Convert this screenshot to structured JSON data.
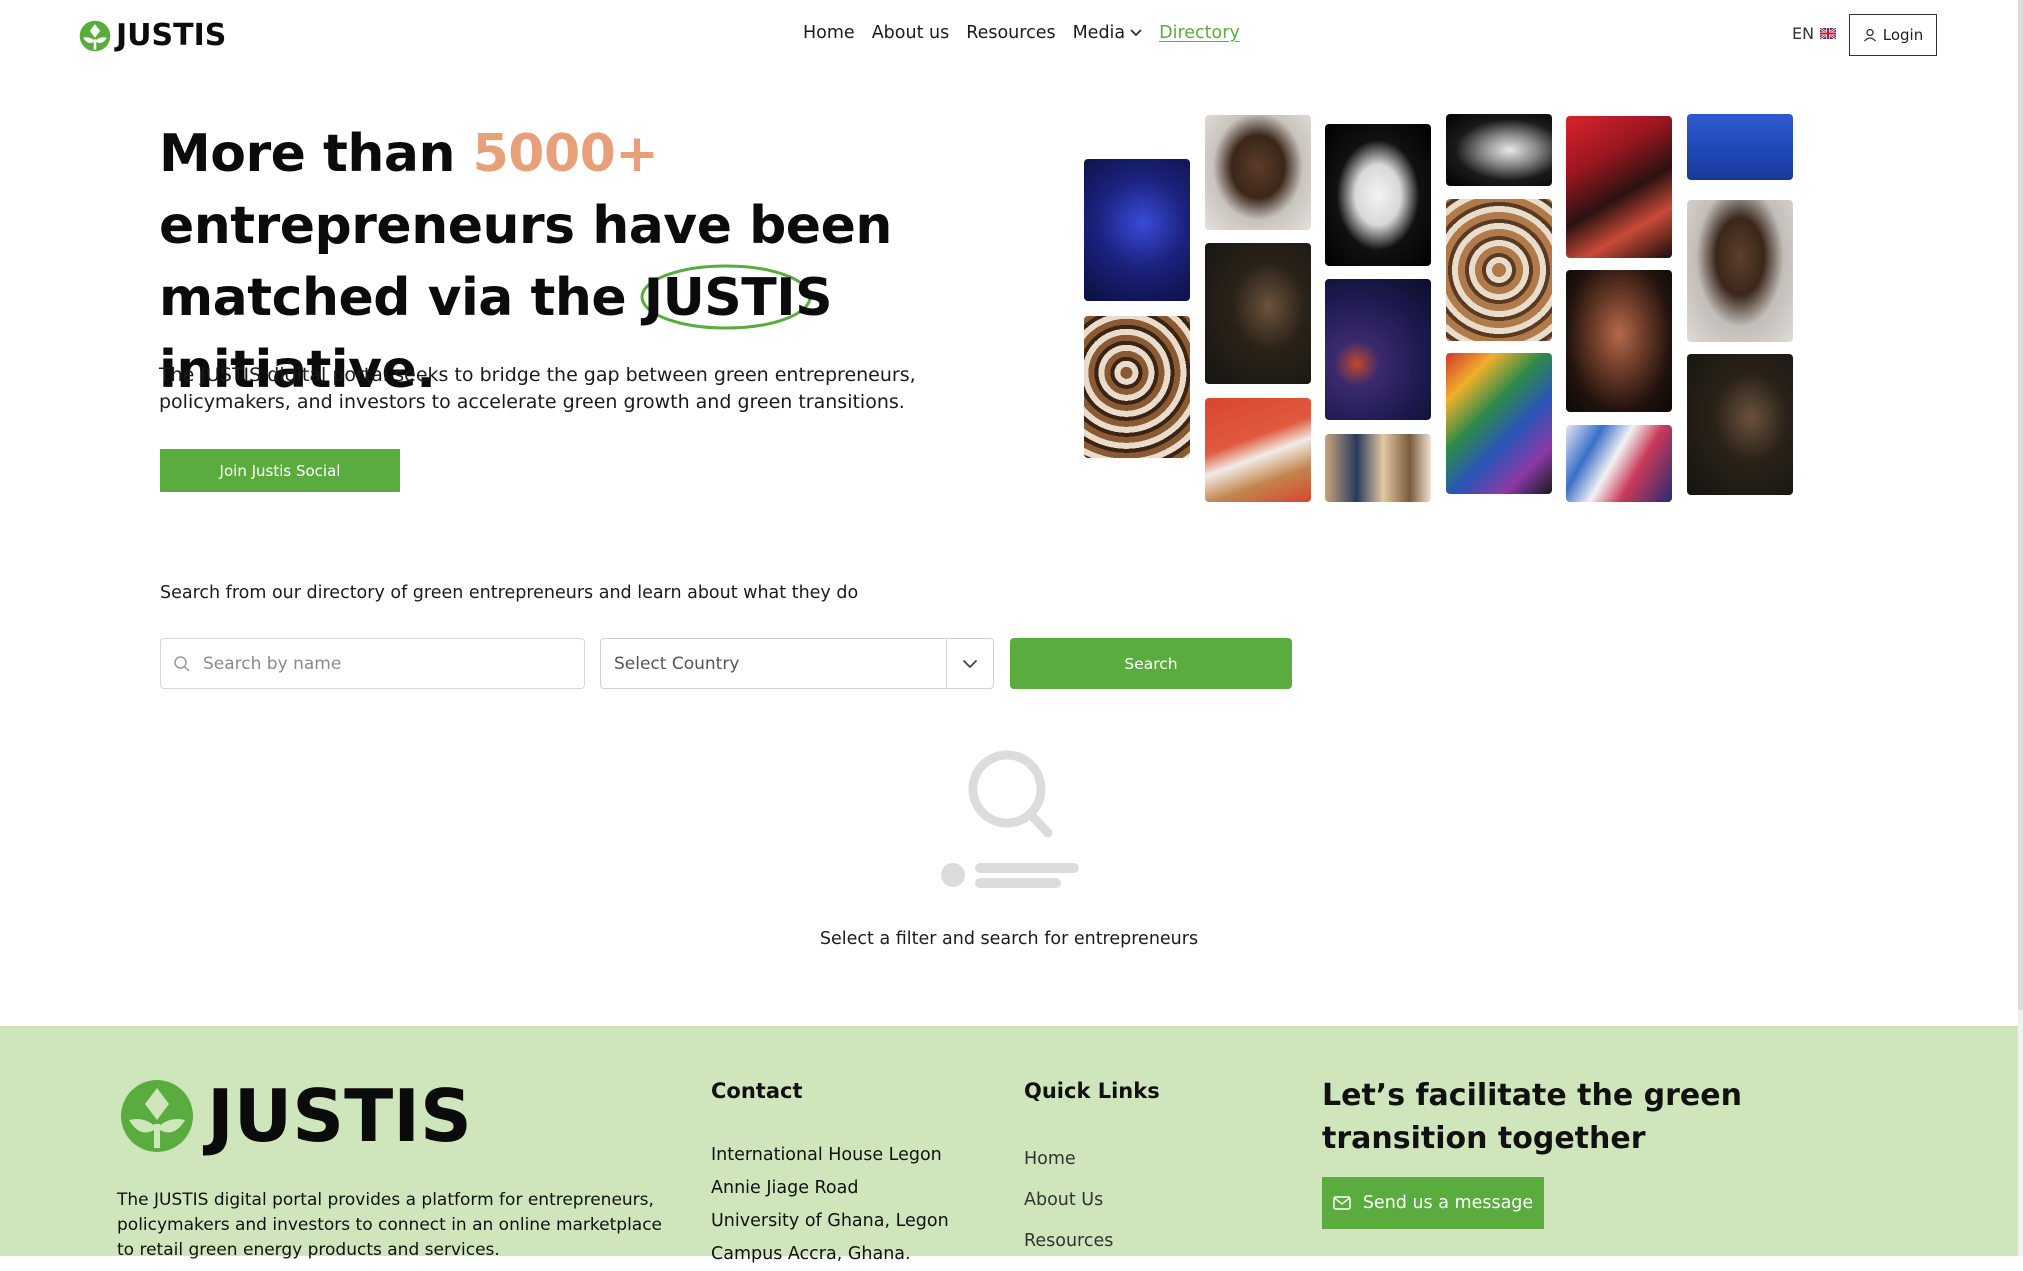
{
  "header": {
    "logo_text": "JUSTIS",
    "nav": {
      "home": "Home",
      "about": "About us",
      "resources": "Resources",
      "media": "Media",
      "directory": "Directory"
    },
    "lang": "EN",
    "login": "Login"
  },
  "hero": {
    "title_part1": "More than ",
    "title_accent": "5000+",
    "title_part2": " entrepreneurs have been matched via the ",
    "title_circled": "JUSTIS",
    "title_part3": " initiative.",
    "description": "The JUSTIS digital portal seeks to bridge the gap between green entrepreneurs, policymakers, and investors to accelerate green growth and green transitions.",
    "cta": "Join Justis Social"
  },
  "search": {
    "lead": "Search from our directory of green entrepreneurs and learn about what they do",
    "name_placeholder": "Search by name",
    "country_value": "Select Country",
    "button": "Search",
    "empty_text": "Select a filter and search for entrepreneurs"
  },
  "footer": {
    "logo_text": "JUSTIS",
    "description": "The JUSTIS digital portal provides a platform for entrepreneurs, policymakers and investors to connect in an online marketplace to retail green energy products and services.",
    "contact_title": "Contact",
    "contact_lines": [
      "International House Legon",
      "Annie Jiage Road",
      "University of Ghana, Legon",
      "Campus Accra, Ghana."
    ],
    "links_title": "Quick Links",
    "links": [
      "Home",
      "About Us",
      "Resources"
    ],
    "cta_title": "Let’s facilitate the green transition together",
    "cta_button": "Send us a message"
  },
  "colors": {
    "brand_green": "#5aac3e",
    "accent_orange": "#e8a07a",
    "footer_bg": "#cfe6bd"
  }
}
